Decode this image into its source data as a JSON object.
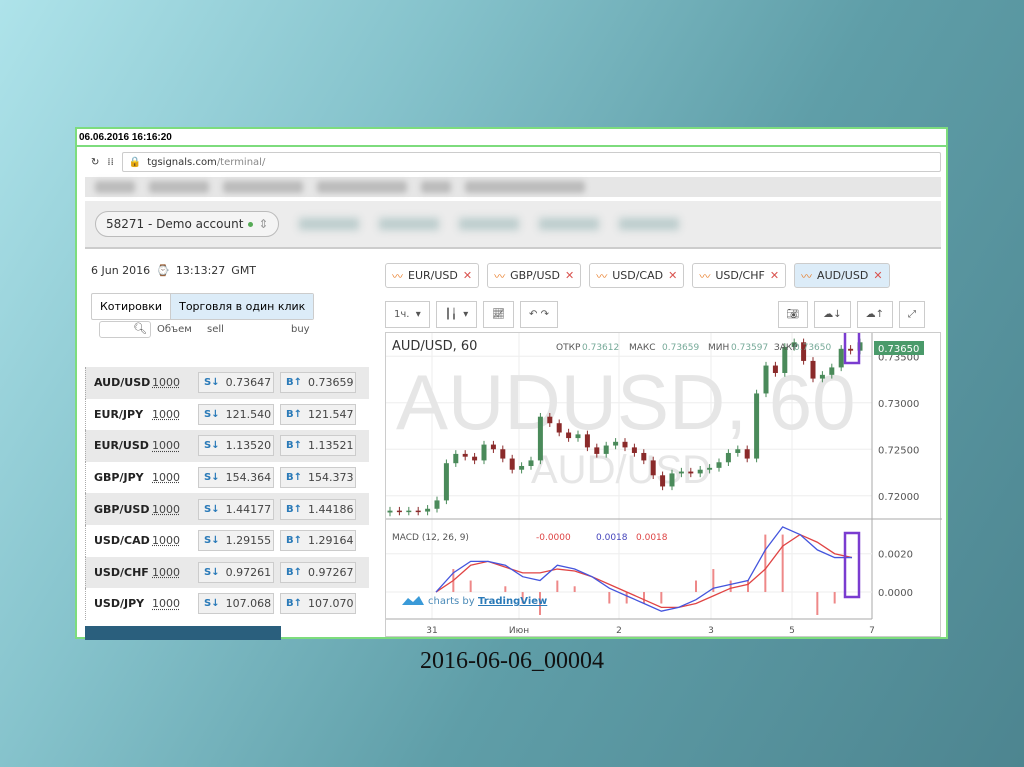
{
  "slide": {
    "caption": "2016-06-06_00004"
  },
  "capture": {
    "timestamp": "06.06.2016 16:16:20"
  },
  "browser": {
    "url_host": "tgsignals.com",
    "url_path": "/terminal/"
  },
  "account": {
    "label": "58271 - Demo account",
    "status_color": "#55aa55"
  },
  "clock": {
    "date": "6 Jun 2016",
    "time": "13:13:27",
    "tz": "GMT"
  },
  "left_tabs": [
    "Котировки",
    "Торговля в один клик"
  ],
  "quote_headers": {
    "volume": "Объем",
    "sell": "sell",
    "buy": "buy"
  },
  "quotes": [
    {
      "symbol": "AUD/USD",
      "volume": "1000",
      "sell": "0.73647",
      "buy": "0.73659"
    },
    {
      "symbol": "EUR/JPY",
      "volume": "1000",
      "sell": "121.540",
      "buy": "121.547"
    },
    {
      "symbol": "EUR/USD",
      "volume": "1000",
      "sell": "1.13520",
      "buy": "1.13521"
    },
    {
      "symbol": "GBP/JPY",
      "volume": "1000",
      "sell": "154.364",
      "buy": "154.373"
    },
    {
      "symbol": "GBP/USD",
      "volume": "1000",
      "sell": "1.44177",
      "buy": "1.44186"
    },
    {
      "symbol": "USD/CAD",
      "volume": "1000",
      "sell": "1.29155",
      "buy": "1.29164"
    },
    {
      "symbol": "USD/CHF",
      "volume": "1000",
      "sell": "0.97261",
      "buy": "0.97267"
    },
    {
      "symbol": "USD/JPY",
      "volume": "1000",
      "sell": "107.068",
      "buy": "107.070"
    }
  ],
  "sell_prefix": "S↓",
  "buy_prefix": "B↑",
  "chart_tabs": [
    {
      "label": "EUR/USD"
    },
    {
      "label": "GBP/USD"
    },
    {
      "label": "USD/CAD"
    },
    {
      "label": "USD/CHF"
    },
    {
      "label": "AUD/USD",
      "active": true
    }
  ],
  "toolbar": {
    "interval": "1ч."
  },
  "chart_data": {
    "type": "candlestick",
    "title": "AUD/USD, 60",
    "watermark": "AUDUSD, 60",
    "watermark_sub": "AUD/USD",
    "ohlc_legend": {
      "open_label": "ОТКР",
      "open": "0.73612",
      "high_label": "МАКС",
      "high": "0.73659",
      "low_label": "МИН",
      "low": "0.73597",
      "close_label": "ЗАКР",
      "close": "0.73650"
    },
    "last_price": "0.73650",
    "y_ticks": [
      "0.73500",
      "0.73000",
      "0.72500",
      "0.72000"
    ],
    "ylim": [
      0.7175,
      0.7375
    ],
    "x_ticks": [
      "31",
      "Июн",
      "2",
      "3",
      "5",
      "7"
    ],
    "closes": [
      0.7184,
      0.7183,
      0.7184,
      0.7183,
      0.7186,
      0.7195,
      0.7235,
      0.7245,
      0.7242,
      0.7238,
      0.7255,
      0.725,
      0.724,
      0.7228,
      0.7232,
      0.7238,
      0.7285,
      0.7278,
      0.7268,
      0.7262,
      0.7266,
      0.7252,
      0.7245,
      0.7254,
      0.7258,
      0.7252,
      0.7246,
      0.7238,
      0.7222,
      0.721,
      0.7224,
      0.7226,
      0.7224,
      0.7228,
      0.723,
      0.7236,
      0.7246,
      0.725,
      0.724,
      0.731,
      0.734,
      0.7332,
      0.736,
      0.7365,
      0.7345,
      0.7326,
      0.733,
      0.7338,
      0.7358,
      0.7356,
      0.7365
    ],
    "macd": {
      "label": "MACD (12, 26, 9)",
      "values_text": [
        "-0.0000",
        "0.0018",
        "0.0018"
      ],
      "y_ticks": [
        "0.0020",
        "0.0000"
      ],
      "ylim": [
        -0.0012,
        0.0035
      ],
      "macd_line": [
        0.0,
        0.001,
        0.0016,
        0.0016,
        0.0014,
        0.0008,
        0.0006,
        0.0014,
        0.0012,
        0.0008,
        0.0002,
        -0.0002,
        -0.0006,
        -0.001,
        -0.0008,
        -0.0004,
        0.0002,
        0.0004,
        0.0006,
        0.0022,
        0.0034,
        0.003,
        0.0022,
        0.0018,
        0.0018
      ],
      "signal_line": [
        0.0,
        0.0006,
        0.0014,
        0.0016,
        0.0013,
        0.001,
        0.001,
        0.0012,
        0.0011,
        0.0008,
        0.0004,
        0.0,
        -0.0004,
        -0.0008,
        -0.0008,
        -0.0006,
        -0.0002,
        0.0002,
        0.0004,
        0.0012,
        0.0024,
        0.003,
        0.0026,
        0.002,
        0.0018
      ]
    },
    "colors": {
      "up": "#4a8a5a",
      "down": "#8a2a2a",
      "macd": "#4455dd",
      "signal": "#e04444",
      "highlight": "#7a3cd0"
    }
  },
  "branding": {
    "prefix": "charts by",
    "name": "TradingView"
  }
}
